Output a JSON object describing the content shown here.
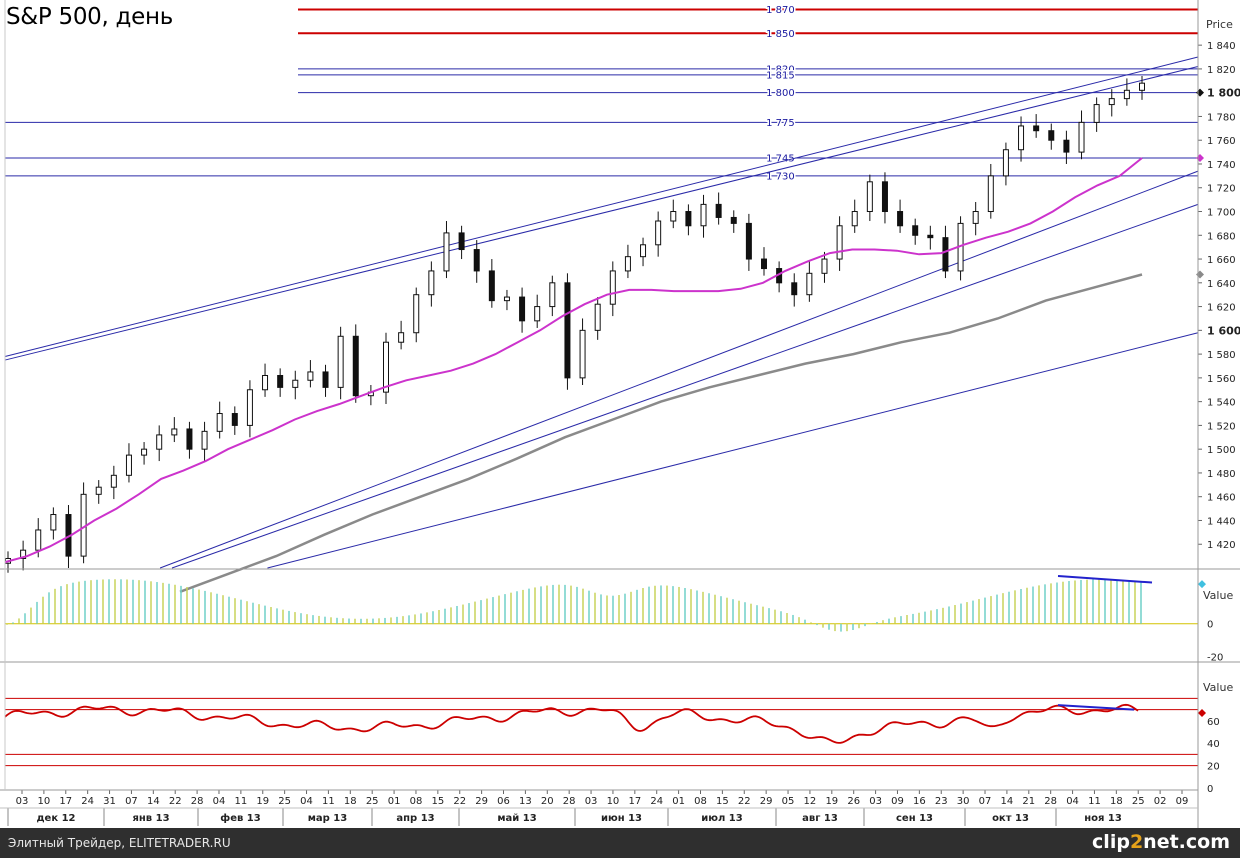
{
  "title": "S&P 500, день",
  "footer": {
    "credit": "Элитный Трейдер, ELITETRADER.RU",
    "logo_main": "clip",
    "logo_two": "2",
    "logo_tail": "net.com"
  },
  "chart_data": [
    {
      "type": "line",
      "title": "S&P 500, день",
      "ylabel": "Price",
      "ylim": [
        1400,
        1878
      ],
      "y_ticks": [
        "1 420",
        "1 440",
        "1 460",
        "1 480",
        "1 500",
        "1 520",
        "1 540",
        "1 560",
        "1 580",
        "1 600",
        "1 620",
        "1 640",
        "1 660",
        "1 680",
        "1 700",
        "1 720",
        "1 740",
        "1 760",
        "1 780",
        "1 800",
        "1 820",
        "1 840"
      ],
      "y_ticks_bold": [
        "1 600",
        "1 800"
      ],
      "x_day_ticks": [
        "03",
        "10",
        "17",
        "24",
        "31",
        "07",
        "14",
        "22",
        "28",
        "04",
        "11",
        "19",
        "25",
        "04",
        "11",
        "18",
        "25",
        "01",
        "08",
        "15",
        "22",
        "29",
        "06",
        "13",
        "20",
        "28",
        "03",
        "10",
        "17",
        "24",
        "01",
        "08",
        "15",
        "22",
        "29",
        "05",
        "12",
        "19",
        "26",
        "03",
        "09",
        "16",
        "23",
        "30",
        "07",
        "14",
        "21",
        "28",
        "04",
        "11",
        "18",
        "25",
        "02",
        "09"
      ],
      "x_month_labels": [
        "дек 12",
        "янв 13",
        "фев 13",
        "мар 13",
        "апр 13",
        "май 13",
        "июн 13",
        "июл 13",
        "авг 13",
        "сен 13",
        "окт 13",
        "ноя 13"
      ],
      "series": [
        {
          "values": [
            1408,
            1415,
            1432,
            1445,
            1410,
            1462,
            1468,
            1478,
            1495,
            1500,
            1512,
            1517,
            1500,
            1515,
            1530,
            1520,
            1550,
            1562,
            1552,
            1558,
            1565,
            1552,
            1595,
            1545,
            1548,
            1590,
            1598,
            1630,
            1650,
            1682,
            1668,
            1650,
            1625,
            1628,
            1608,
            1620,
            1640,
            1560,
            1600,
            1622,
            1650,
            1662,
            1672,
            1692,
            1700,
            1688,
            1706,
            1695,
            1690,
            1660,
            1652,
            1640,
            1630,
            1648,
            1660,
            1688,
            1700,
            1725,
            1700,
            1688,
            1680,
            1678,
            1650,
            1690,
            1700,
            1730,
            1752,
            1772,
            1768,
            1760,
            1750,
            1775,
            1790,
            1795,
            1802,
            1808
          ]
        },
        {
          "values": [
            1405,
            1410,
            1418,
            1428,
            1440,
            1450,
            1462,
            1475,
            1482,
            1490,
            1500,
            1508,
            1516,
            1525,
            1532,
            1538,
            1545,
            1552,
            1558,
            1562,
            1566,
            1572,
            1580,
            1590,
            1600,
            1612,
            1622,
            1630,
            1634,
            1634,
            1633,
            1633,
            1633,
            1635,
            1640,
            1650,
            1658,
            1665,
            1668,
            1668,
            1667,
            1664,
            1665,
            1672,
            1678,
            1683,
            1690,
            1700,
            1712,
            1722,
            1730,
            1745
          ]
        },
        {
          "values": [
            1380,
            1395,
            1410,
            1428,
            1445,
            1460,
            1475,
            1492,
            1510,
            1525,
            1540,
            1552,
            1562,
            1572,
            1580,
            1590,
            1598,
            1610,
            1625,
            1636,
            1647
          ]
        }
      ],
      "horizontal_levels": [
        {
          "label": "1 870",
          "value": 1870,
          "color": "#cc0000"
        },
        {
          "label": "1 850",
          "value": 1850,
          "color": "#cc0000"
        },
        {
          "label": "1 820",
          "value": 1820,
          "color": "#2a2aa8"
        },
        {
          "label": "1 815",
          "value": 1815,
          "color": "#2a2aa8"
        },
        {
          "label": "1 800",
          "value": 1800,
          "color": "#2a2aa8"
        },
        {
          "label": "1 775",
          "value": 1775,
          "color": "#2a2aa8"
        },
        {
          "label": "1 745",
          "value": 1745,
          "color": "#2a2aa8"
        },
        {
          "label": "1 730",
          "value": 1730,
          "color": "#2a2aa8"
        }
      ],
      "trendlines": [
        {
          "from": [
            0,
            1578
          ],
          "to": [
            1,
            1830
          ]
        },
        {
          "from": [
            0,
            1575
          ],
          "to": [
            1,
            1822
          ]
        },
        {
          "from": [
            0.13,
            1400
          ],
          "to": [
            1,
            1734
          ]
        },
        {
          "from": [
            0.14,
            1400
          ],
          "to": [
            1,
            1706
          ]
        },
        {
          "from": [
            0.22,
            1400
          ],
          "to": [
            1,
            1598
          ]
        }
      ]
    },
    {
      "type": "bar",
      "ylabel": "Value",
      "ylim": [
        -22,
        32
      ],
      "y_ticks": [
        "0",
        "-20"
      ]
    },
    {
      "type": "line",
      "ylabel": "Value",
      "ylim": [
        0,
        100
      ],
      "y_ticks": [
        "0",
        "20",
        "40",
        "60"
      ],
      "levels": [
        20,
        30,
        70,
        80
      ]
    }
  ]
}
